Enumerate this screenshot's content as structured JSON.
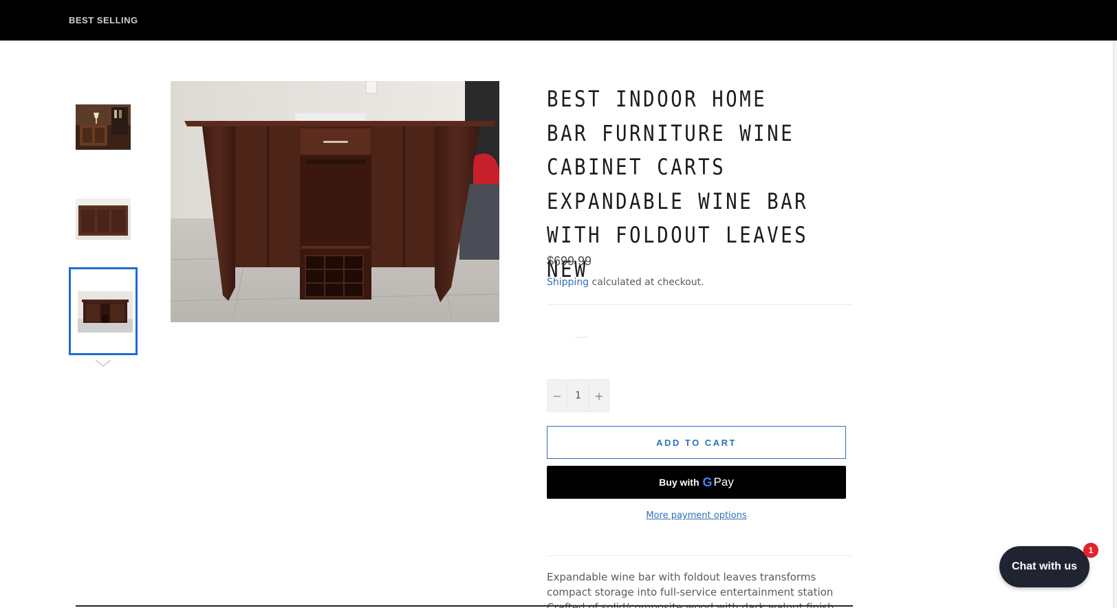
{
  "nav": {
    "best_selling": "BEST SELLING"
  },
  "product": {
    "title": "BEST INDOOR HOME BAR FURNITURE WINE CABINET CARTS EXPANDABLE WINE BAR WITH FOLDOUT LEAVES NEW",
    "price": "$699.99",
    "shipping_link": "Shipping",
    "shipping_text": " calculated at checkout.",
    "quantity": "1",
    "decrement_label": "−",
    "increment_label": "+",
    "add_to_cart": "ADD TO CART",
    "buy_with": "Buy with",
    "gpay_g": "G",
    "gpay_pay": "Pay",
    "more_payment_options": "More payment options",
    "description_line1": "Expandable wine bar with foldout leaves transforms",
    "description_line2": "compact storage into full-service entertainment station",
    "description_line3": "Crafted of solid/composite wood with dark walnut finish"
  },
  "chat": {
    "label": "Chat with us",
    "badge_count": "1"
  },
  "thumbnails": {
    "active_index": 3,
    "count_visible": 3
  },
  "colors": {
    "accent": "#2e6fb8",
    "active_thumb_border": "#1e6ad6",
    "topbar": "#000000",
    "chat_bg": "#1f2430",
    "badge": "#e3222f"
  },
  "icons": {
    "next_thumbnail": "chevron-down-icon"
  }
}
